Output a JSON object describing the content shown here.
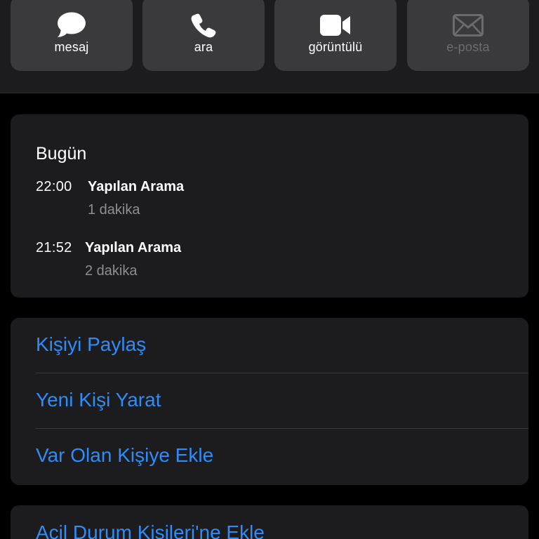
{
  "actions": [
    {
      "label": "mesaj",
      "icon": "message-bubble-icon",
      "enabled": true
    },
    {
      "label": "ara",
      "icon": "phone-icon",
      "enabled": true
    },
    {
      "label": "görüntülü",
      "icon": "video-camera-icon",
      "enabled": true
    },
    {
      "label": "e-posta",
      "icon": "envelope-icon",
      "enabled": false
    }
  ],
  "history": {
    "title": "Bugün",
    "calls": [
      {
        "time": "22:00",
        "type": "Yapılan Arama",
        "duration": "1 dakika"
      },
      {
        "time": "21:52",
        "type": "Yapılan Arama",
        "duration": "2 dakika"
      }
    ]
  },
  "contact_actions": {
    "share": "Kişiyi Paylaş",
    "new_contact": "Yeni Kişi Yarat",
    "add_existing": "Var Olan Kişiye Ekle"
  },
  "emergency": {
    "label": "Acil Durum Kişileri'ne Ekle"
  },
  "colors": {
    "accent": "#2f8cf6",
    "card_bg": "#1c1c1e",
    "button_bg": "#3a3a3c",
    "secondary_text": "#8e8e93",
    "disabled_text": "#6b6b70"
  }
}
